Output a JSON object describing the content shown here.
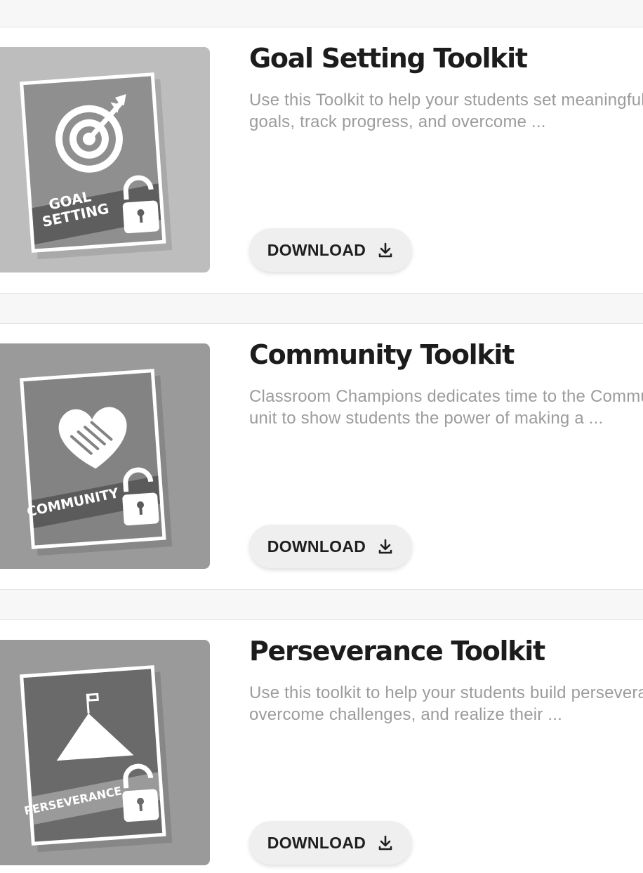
{
  "toolkits": [
    {
      "title": "Goal Setting Toolkit",
      "description": "Use this Toolkit to help your students set meaningful goals, track progress, and overcome ...",
      "badge_lines": [
        "GOAL",
        "SETTING"
      ],
      "icon": "target-icon",
      "download_label": "DOWNLOAD"
    },
    {
      "title": "Community Toolkit",
      "description": "Classroom Champions dedicates time to the Community unit to show students the power of making a ...",
      "badge_lines": [
        "COMMUNITY"
      ],
      "icon": "heart-handshake-icon",
      "download_label": "DOWNLOAD"
    },
    {
      "title": "Perseverance Toolkit",
      "description": "Use this toolkit to help your students build perseverance, overcome challenges, and realize their ...",
      "badge_lines": [
        "PERSEVERANCE"
      ],
      "icon": "mountain-flag-icon",
      "download_label": "DOWNLOAD"
    }
  ],
  "colors": {
    "page_bg": "#f7f7f7",
    "card_bg": "#ffffff",
    "title": "#1c1c1c",
    "description": "#9c9c9c",
    "button_bg": "#efefef"
  }
}
